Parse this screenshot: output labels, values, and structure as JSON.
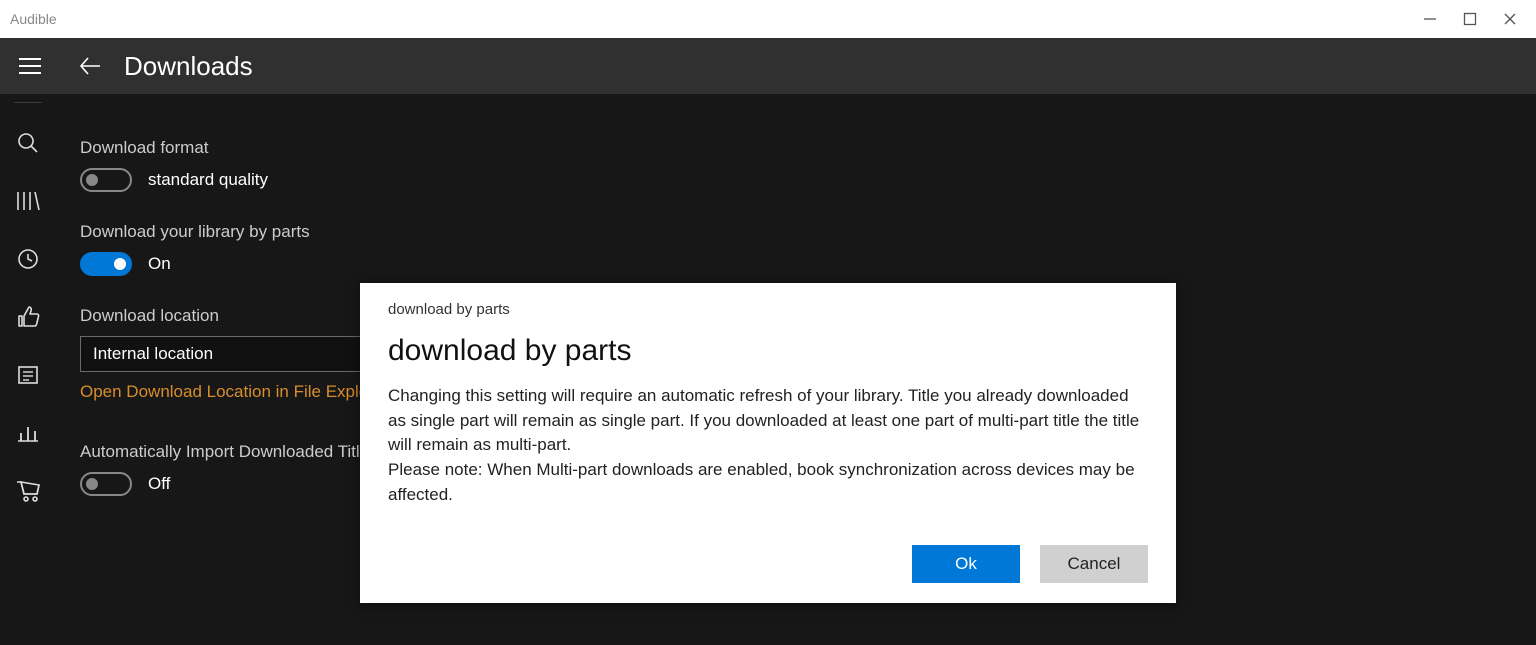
{
  "window": {
    "title": "Audible"
  },
  "header": {
    "title": "Downloads"
  },
  "settings": {
    "download_format": {
      "label": "Download format",
      "value": "standard quality",
      "on": false
    },
    "download_by_parts": {
      "label": "Download your library by parts",
      "value": "On",
      "on": true
    },
    "download_location": {
      "label": "Download location",
      "value": "Internal location",
      "link": "Open Download Location in File Explorer"
    },
    "auto_import": {
      "label": "Automatically Import Downloaded Titles",
      "value": "Off",
      "on": false
    }
  },
  "dialog": {
    "tag": "download by parts",
    "title": "download by parts",
    "body1": "Changing this setting will require an automatic refresh of your library. Title you already downloaded as single part will remain as single part. If you downloaded at least one part of multi-part title the title will remain as multi-part.",
    "body2": "Please note: When Multi-part downloads are enabled, book synchronization across devices may be affected.",
    "ok": "Ok",
    "cancel": "Cancel"
  }
}
